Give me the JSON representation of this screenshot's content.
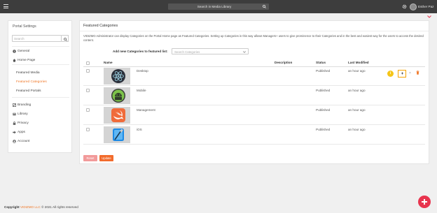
{
  "topbar": {
    "search_text": "Search in Media Library",
    "user_name": "Esther Paz",
    "icons": {
      "menu": "hamburger-icon",
      "search": "search-icon",
      "settings": "gear-icon",
      "collapse": "chevron-down-icon"
    }
  },
  "sidebar": {
    "title": "Portal Settings",
    "search_placeholder": "Search",
    "items": [
      {
        "label": "General",
        "icon": "info-icon"
      },
      {
        "label": "Home Page",
        "icon": "home-icon"
      },
      {
        "label": "Branding",
        "icon": "branding-icon"
      },
      {
        "label": "Library",
        "icon": "library-icon"
      },
      {
        "label": "Privacy",
        "icon": "lock-icon"
      },
      {
        "label": "Apps",
        "icon": "apps-icon"
      },
      {
        "label": "Account",
        "icon": "account-icon"
      }
    ],
    "home_sub": [
      {
        "label": "Featured Media"
      },
      {
        "label": "Featured Categories",
        "active": true
      },
      {
        "label": "Featured Portals"
      }
    ]
  },
  "main": {
    "title": "Featured Categories",
    "description": "VIDIZMO Administrator can display Categories on the Portal Home page as Featured Categories. Setting up Categories in this way allows Managers+ users to give prominence to their Categories and in the best and easiest way for the users to access the desired content.",
    "add_label": "Add new Categories to featured list:",
    "select_placeholder": "Search Categories",
    "columns": {
      "name": "Name",
      "description": "Description",
      "status": "Status",
      "last_modified": "Last Modified"
    },
    "rows": [
      {
        "name": "Desktop",
        "description": "",
        "status": "Published",
        "modified": "an hour ago",
        "thumb_icon": "electron-icon"
      },
      {
        "name": "Mobile",
        "description": "",
        "status": "Published",
        "modified": "an hour ago",
        "thumb_icon": "android-icon"
      },
      {
        "name": "Management",
        "description": "",
        "status": "Published",
        "modified": "an hour ago",
        "thumb_icon": "swift-icon"
      },
      {
        "name": "iOS",
        "description": "",
        "status": "Published",
        "modified": "an hour ago",
        "thumb_icon": "xcode-icon"
      }
    ],
    "row_actions": {
      "info": "i",
      "close": "×"
    },
    "reset_label": "Reset",
    "update_label": "Update"
  },
  "footer": {
    "prefix": "Copyright",
    "brand": "VIDIZMO LLC",
    "rest": "© 2021 All rights reserved"
  },
  "colors": {
    "accent": "#f07828",
    "topbar": "#3d3d3d",
    "fab": "#e8344e",
    "pin_border": "#f5a300"
  }
}
